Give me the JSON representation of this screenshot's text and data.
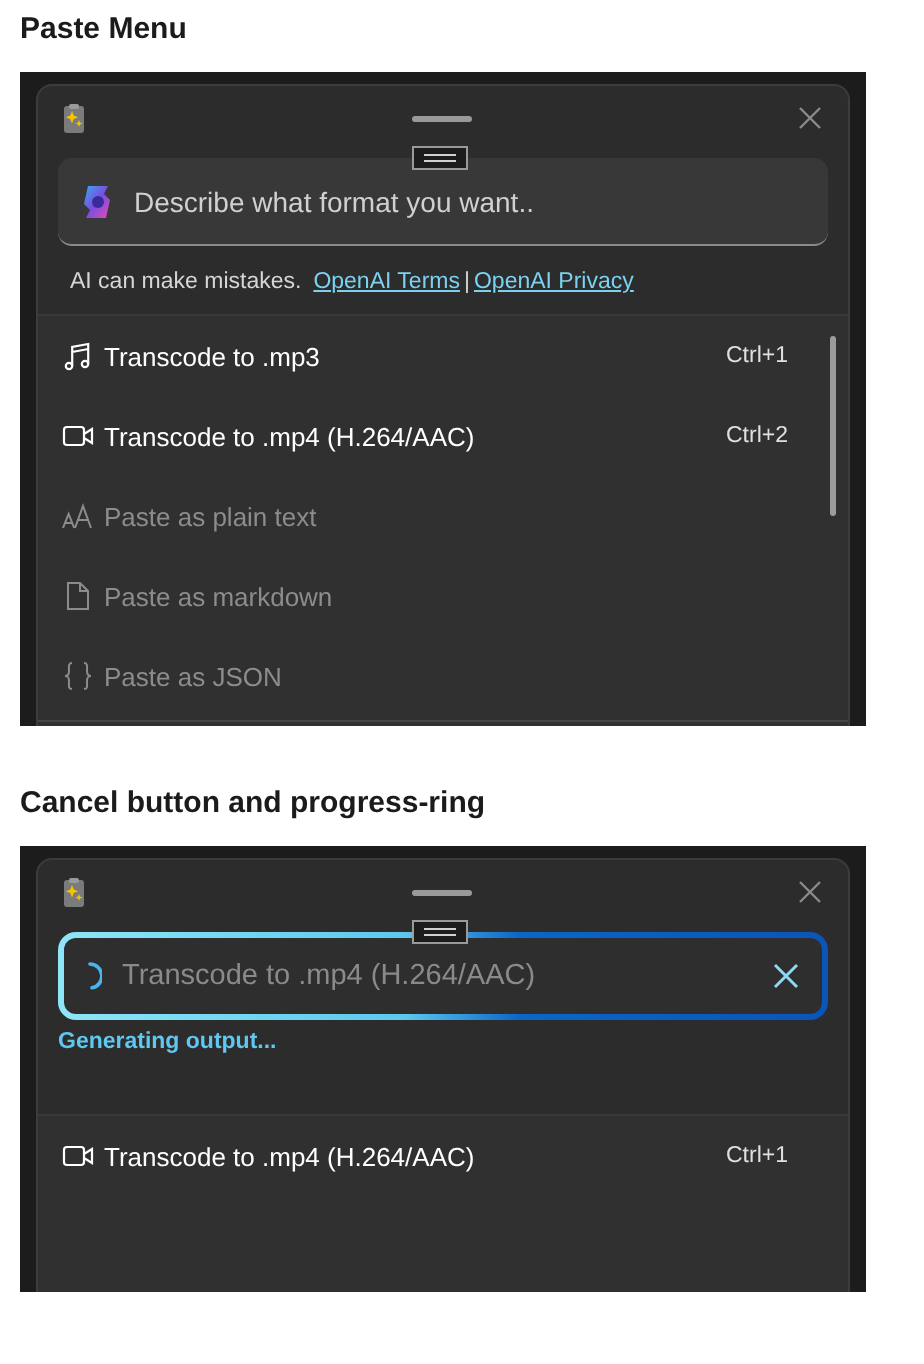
{
  "sections": [
    {
      "heading": "Paste Menu",
      "window": {
        "prompt": {
          "generating": false,
          "placeholder": "Describe what format you want.."
        },
        "disclaimer": "AI can make mistakes.",
        "links": [
          "OpenAI Terms",
          "OpenAI Privacy"
        ],
        "link_separator": "|",
        "scrollbar": true,
        "items": [
          {
            "kind": "music",
            "label": "Transcode to .mp3",
            "shortcut": "Ctrl+1",
            "disabled": false
          },
          {
            "kind": "video",
            "label": "Transcode to .mp4 (H.264/AAC)",
            "shortcut": "Ctrl+2",
            "disabled": false
          },
          {
            "kind": "text",
            "label": "Paste as plain text",
            "disabled": true
          },
          {
            "kind": "file",
            "label": "Paste as markdown",
            "disabled": true
          },
          {
            "kind": "json",
            "label": "Paste as JSON",
            "disabled": true
          }
        ]
      }
    },
    {
      "heading": "Cancel button and progress-ring",
      "window": {
        "prompt": {
          "generating": true,
          "value": "Transcode to .mp4 (H.264/AAC)"
        },
        "status": "Generating output...",
        "scrollbar": false,
        "items": [
          {
            "kind": "video",
            "label": "Transcode to .mp4 (H.264/AAC)",
            "shortcut": "Ctrl+1",
            "disabled": false
          }
        ]
      }
    }
  ]
}
